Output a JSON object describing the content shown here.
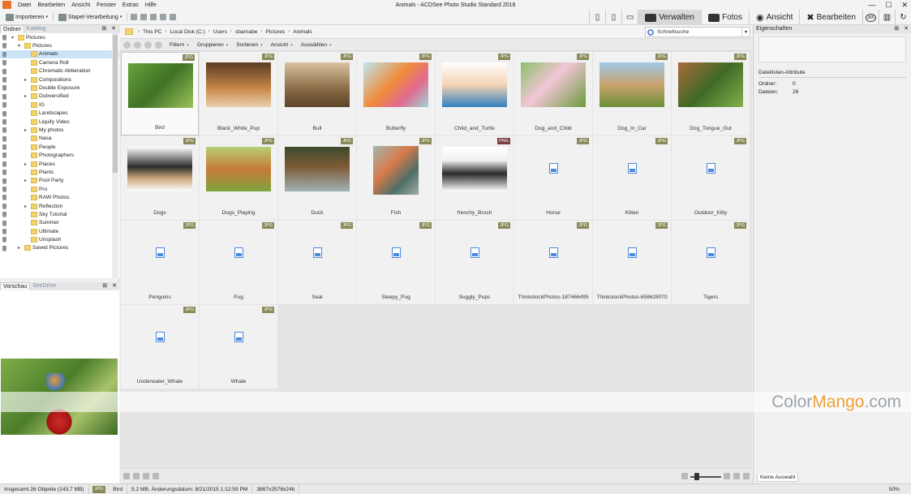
{
  "app": {
    "title": "Animals - ACDSee Photo Studio Standard 2018",
    "menu": [
      "Datei",
      "Bearbeiten",
      "Ansicht",
      "Fenster",
      "Extras",
      "Hilfe"
    ]
  },
  "toolbar": {
    "import_label": "Importieren",
    "batch_label": "Stapel-Verarbeitung",
    "modes": [
      "Verwalten",
      "Fotos",
      "Ansicht",
      "Bearbeiten"
    ],
    "active_mode": "Verwalten",
    "extra_icon": "365"
  },
  "left_panel": {
    "tabs": [
      "Ordner",
      "Katalog"
    ],
    "tree": [
      {
        "label": "Pictures",
        "indent": 1,
        "arrow": "▾"
      },
      {
        "label": "Pictures",
        "indent": 2,
        "arrow": "▾"
      },
      {
        "label": "Animals",
        "indent": 3,
        "selected": true
      },
      {
        "label": "Camera Roll",
        "indent": 3
      },
      {
        "label": "Chromatic Abberation",
        "indent": 3
      },
      {
        "label": "Compositions",
        "indent": 3,
        "arrow": "▸"
      },
      {
        "label": "Double Exposure",
        "indent": 3
      },
      {
        "label": "Dubversified",
        "indent": 3,
        "arrow": "▸"
      },
      {
        "label": "IG",
        "indent": 3
      },
      {
        "label": "Landscapes",
        "indent": 3
      },
      {
        "label": "Liquify Video",
        "indent": 3
      },
      {
        "label": "My photos",
        "indent": 3,
        "arrow": "▸"
      },
      {
        "label": "Nasa",
        "indent": 3
      },
      {
        "label": "People",
        "indent": 3
      },
      {
        "label": "Photographers",
        "indent": 3
      },
      {
        "label": "Places",
        "indent": 3,
        "arrow": "▸"
      },
      {
        "label": "Plants",
        "indent": 3
      },
      {
        "label": "Pool Party",
        "indent": 3,
        "arrow": "▸"
      },
      {
        "label": "Pro",
        "indent": 3
      },
      {
        "label": "RAW Photos",
        "indent": 3
      },
      {
        "label": "Reflection",
        "indent": 3,
        "arrow": "▸"
      },
      {
        "label": "Sky Tutorial",
        "indent": 3
      },
      {
        "label": "Summer",
        "indent": 3
      },
      {
        "label": "Ultimate",
        "indent": 3
      },
      {
        "label": "Unsplash",
        "indent": 3
      },
      {
        "label": "Saved Pictures",
        "indent": 2,
        "arrow": "▸"
      }
    ],
    "preview_tabs": [
      "Vorschau",
      "SeeDrive"
    ]
  },
  "address": {
    "crumbs": [
      "This PC",
      "Local Disk (C:)",
      "Users",
      "sbarnabe",
      "Pictures",
      "Animals"
    ],
    "search_placeholder": "Schnellsuche"
  },
  "filter_bar": [
    "Filtern",
    "Gruppieren",
    "Sortieren",
    "Ansicht",
    "Auswählen"
  ],
  "files": [
    {
      "name": "Bird",
      "type": "JPG",
      "thumb": "bird",
      "selected": true
    },
    {
      "name": "Black_White_Pup",
      "type": "JPG",
      "thumb": "pup"
    },
    {
      "name": "Bull",
      "type": "JPG",
      "thumb": "bull"
    },
    {
      "name": "Butterfly",
      "type": "JPG",
      "thumb": "butterfly"
    },
    {
      "name": "Child_and_Turtle",
      "type": "JPG",
      "thumb": "child"
    },
    {
      "name": "Dog_and_Child",
      "type": "JPG",
      "thumb": "dogchild"
    },
    {
      "name": "Dog_In_Car",
      "type": "JPG",
      "thumb": "dogcar"
    },
    {
      "name": "Dog_Tongue_Out",
      "type": "JPG",
      "thumb": "dogtongue"
    },
    {
      "name": "Dogs",
      "type": "JPG",
      "thumb": "dogs"
    },
    {
      "name": "Dogs_Playing",
      "type": "JPG",
      "thumb": "dogsplaying"
    },
    {
      "name": "Duck",
      "type": "JPG",
      "thumb": "duck"
    },
    {
      "name": "Fish",
      "type": "JPG",
      "thumb": "fish",
      "tall": true
    },
    {
      "name": "frenchy_Brush",
      "type": "PNG",
      "thumb": "frenchy"
    },
    {
      "name": "Horse",
      "type": "JPG"
    },
    {
      "name": "Kitten",
      "type": "JPG"
    },
    {
      "name": "Outdoor_Kitty",
      "type": "JPG"
    },
    {
      "name": "Penguins",
      "type": "JPG"
    },
    {
      "name": "Pug",
      "type": "JPG"
    },
    {
      "name": "Seal",
      "type": "JPG"
    },
    {
      "name": "Sleepy_Pug",
      "type": "JPG"
    },
    {
      "name": "Suggly_Pups",
      "type": "JPG"
    },
    {
      "name": "ThinkstockPhotos-187466495",
      "type": "JPG"
    },
    {
      "name": "ThinkstockPhotos-658628070",
      "type": "JPG"
    },
    {
      "name": "Tigers",
      "type": "JPG"
    },
    {
      "name": "Underwater_Whale",
      "type": "JPG"
    },
    {
      "name": "Whale",
      "type": "JPG"
    }
  ],
  "right_panel": {
    "title": "Eigenschaften",
    "section": "Dateilisten-Attribute",
    "rows": [
      {
        "key": "Ordner:",
        "value": "0"
      },
      {
        "key": "Dateien:",
        "value": "26"
      }
    ],
    "bottom_tab": "Keine Auswahl"
  },
  "statusbar": {
    "total": "Insgesamt 26 Objekte  (143.7 MB)",
    "type": "JPG",
    "name": "Bird",
    "details": "5.2 MB, Änderungsdatum: 8/21/2015 1:12:59 PM",
    "dimensions": "3867x2578x24b",
    "zoom": "50%"
  },
  "watermark": {
    "brand": "Color",
    "accent": "Mango",
    "suffix": ".com"
  },
  "colors": {
    "badge_jpg": "#8b8a5a",
    "badge_png": "#7a3f3f",
    "selection": "#cce4f7",
    "accent": "#f0a03a"
  }
}
